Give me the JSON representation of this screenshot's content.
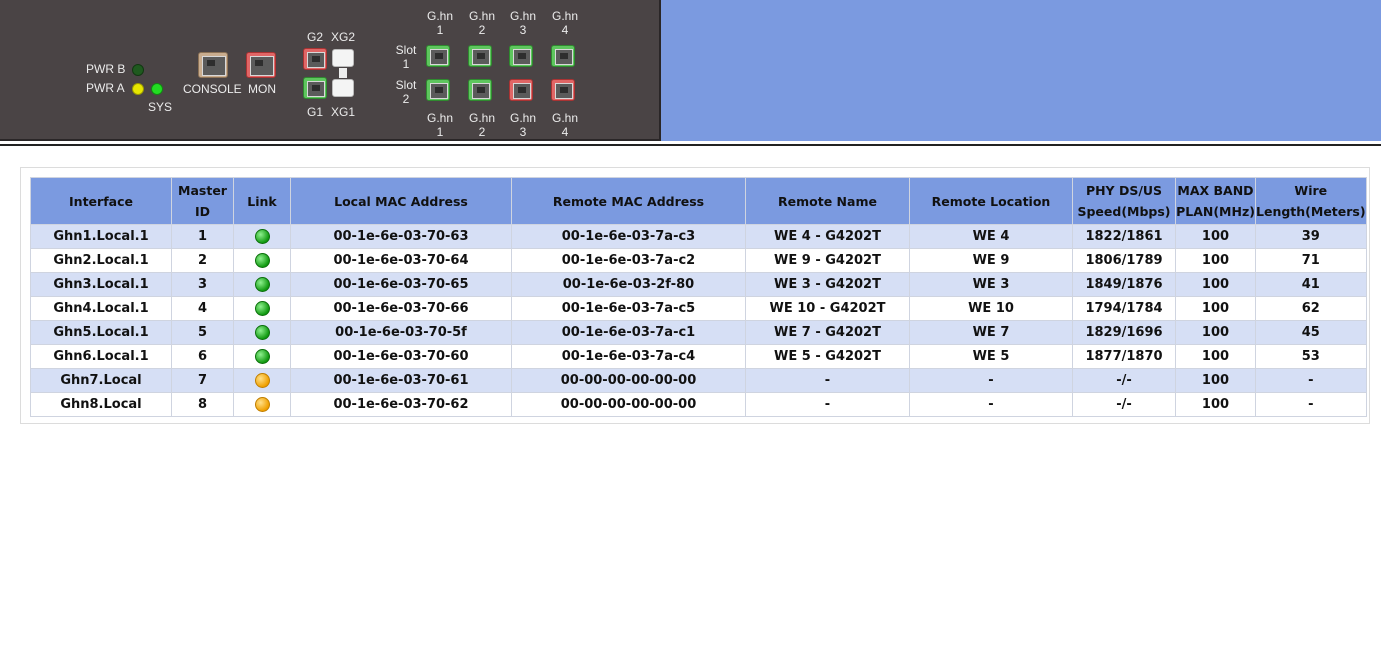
{
  "device": {
    "pwr_b": "PWR B",
    "pwr_a": "PWR A",
    "sys": "SYS",
    "console": "CONSOLE",
    "mon": "MON",
    "g2": "G2",
    "xg2": "XG2",
    "g1": "G1",
    "xg1": "XG1",
    "slot1": [
      "Slot",
      "1"
    ],
    "slot2": [
      "Slot",
      "2"
    ],
    "ghn_top": [
      [
        "G.hn",
        "1"
      ],
      [
        "G.hn",
        "2"
      ],
      [
        "G.hn",
        "3"
      ],
      [
        "G.hn",
        "4"
      ]
    ],
    "ghn_bottom": [
      [
        "G.hn",
        "1"
      ],
      [
        "G.hn",
        "2"
      ],
      [
        "G.hn",
        "3"
      ],
      [
        "G.hn",
        "4"
      ]
    ],
    "leds": {
      "pwr_b": "#1f5a1f",
      "pwr_a": "#e6e600",
      "sys": "#22dd22"
    },
    "ports": {
      "console": "tan",
      "mon": "red",
      "g2": "red",
      "g1": "green",
      "xg2": "white",
      "xg1": "white",
      "slot1": [
        "green",
        "green",
        "green",
        "green"
      ],
      "slot2": [
        "green",
        "green",
        "red",
        "red"
      ]
    }
  },
  "table": {
    "headers": [
      [
        "Interface"
      ],
      [
        "Master",
        "ID"
      ],
      [
        "Link"
      ],
      [
        "Local MAC Address"
      ],
      [
        "Remote MAC Address"
      ],
      [
        "Remote Name"
      ],
      [
        "Remote Location"
      ],
      [
        "PHY DS/US",
        "Speed(Mbps)"
      ],
      [
        "MAX BAND",
        "PLAN(MHz)"
      ],
      [
        "Wire",
        "Length(Meters)"
      ]
    ],
    "rows": [
      {
        "interface": "Ghn1.Local.1",
        "master_id": "1",
        "link": "green",
        "local_mac": "00-1e-6e-03-70-63",
        "remote_mac": "00-1e-6e-03-7a-c3",
        "remote_name": "WE 4 - G4202T",
        "remote_location": "WE 4",
        "phy_speed": "1822/1861",
        "max_band": "100",
        "wire_length": "39"
      },
      {
        "interface": "Ghn2.Local.1",
        "master_id": "2",
        "link": "green",
        "local_mac": "00-1e-6e-03-70-64",
        "remote_mac": "00-1e-6e-03-7a-c2",
        "remote_name": "WE 9 - G4202T",
        "remote_location": "WE 9",
        "phy_speed": "1806/1789",
        "max_band": "100",
        "wire_length": "71"
      },
      {
        "interface": "Ghn3.Local.1",
        "master_id": "3",
        "link": "green",
        "local_mac": "00-1e-6e-03-70-65",
        "remote_mac": "00-1e-6e-03-2f-80",
        "remote_name": "WE 3 - G4202T",
        "remote_location": "WE 3",
        "phy_speed": "1849/1876",
        "max_band": "100",
        "wire_length": "41"
      },
      {
        "interface": "Ghn4.Local.1",
        "master_id": "4",
        "link": "green",
        "local_mac": "00-1e-6e-03-70-66",
        "remote_mac": "00-1e-6e-03-7a-c5",
        "remote_name": "WE 10 - G4202T",
        "remote_location": "WE 10",
        "phy_speed": "1794/1784",
        "max_band": "100",
        "wire_length": "62"
      },
      {
        "interface": "Ghn5.Local.1",
        "master_id": "5",
        "link": "green",
        "local_mac": "00-1e-6e-03-70-5f",
        "remote_mac": "00-1e-6e-03-7a-c1",
        "remote_name": "WE 7 - G4202T",
        "remote_location": "WE 7",
        "phy_speed": "1829/1696",
        "max_band": "100",
        "wire_length": "45"
      },
      {
        "interface": "Ghn6.Local.1",
        "master_id": "6",
        "link": "green",
        "local_mac": "00-1e-6e-03-70-60",
        "remote_mac": "00-1e-6e-03-7a-c4",
        "remote_name": "WE 5 - G4202T",
        "remote_location": "WE 5",
        "phy_speed": "1877/1870",
        "max_band": "100",
        "wire_length": "53"
      },
      {
        "interface": "Ghn7.Local",
        "master_id": "7",
        "link": "orange",
        "local_mac": "00-1e-6e-03-70-61",
        "remote_mac": "00-00-00-00-00-00",
        "remote_name": "-",
        "remote_location": "-",
        "phy_speed": "-/-",
        "max_band": "100",
        "wire_length": "-"
      },
      {
        "interface": "Ghn8.Local",
        "master_id": "8",
        "link": "orange",
        "local_mac": "00-1e-6e-03-70-62",
        "remote_mac": "00-00-00-00-00-00",
        "remote_name": "-",
        "remote_location": "-",
        "phy_speed": "-/-",
        "max_band": "100",
        "wire_length": "-"
      }
    ]
  }
}
